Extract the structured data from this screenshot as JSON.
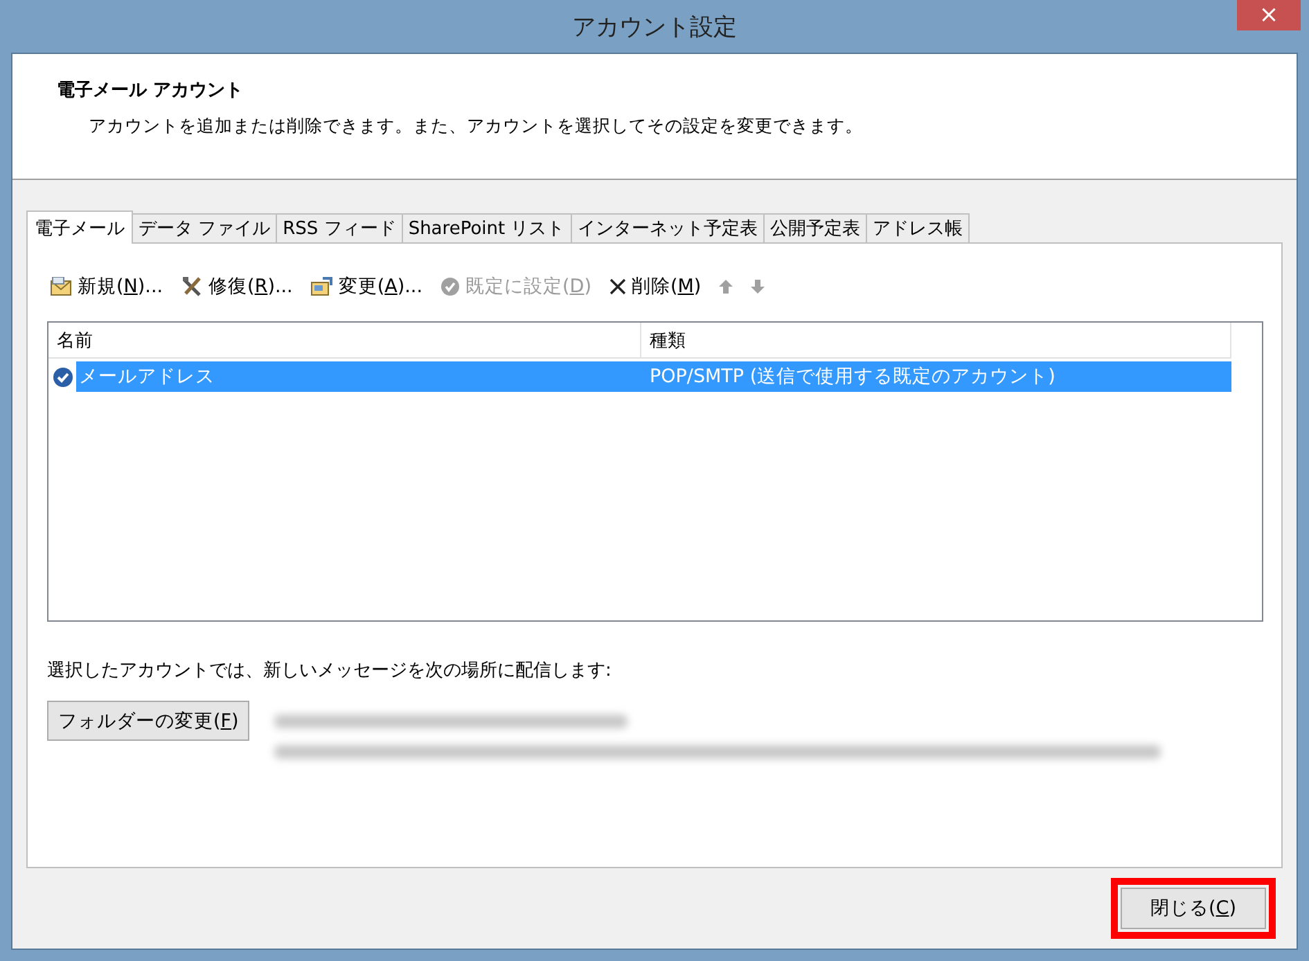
{
  "window": {
    "title": "アカウント設定",
    "close": "×"
  },
  "header": {
    "title": "電子メール アカウント",
    "description": "アカウントを追加または削除できます。また、アカウントを選択してその設定を変更できます。"
  },
  "tabs": [
    {
      "label": "電子メール",
      "selected": true
    },
    {
      "label": "データ ファイル",
      "selected": false
    },
    {
      "label": "RSS フィード",
      "selected": false
    },
    {
      "label": "SharePoint リスト",
      "selected": false
    },
    {
      "label": "インターネット予定表",
      "selected": false
    },
    {
      "label": "公開予定表",
      "selected": false
    },
    {
      "label": "アドレス帳",
      "selected": false
    }
  ],
  "toolbar": [
    {
      "kind": "new",
      "text": "新規(",
      "key": "N",
      "tail": ")...",
      "disabled": false
    },
    {
      "kind": "repair",
      "text": "修復(",
      "key": "R",
      "tail": ")...",
      "disabled": false
    },
    {
      "kind": "change",
      "text": "変更(",
      "key": "A",
      "tail": ")...",
      "disabled": false
    },
    {
      "kind": "default",
      "text": "既定に設定(",
      "key": "D",
      "tail": ")",
      "disabled": true
    },
    {
      "kind": "delete",
      "text": "削除(",
      "key": "M",
      "tail": ")",
      "disabled": false
    },
    {
      "kind": "up",
      "disabled": true
    },
    {
      "kind": "down",
      "disabled": true
    }
  ],
  "table": {
    "columns": [
      "名前",
      "種類"
    ],
    "rows": [
      {
        "name": "メールアドレス",
        "type": "POP/SMTP (送信で使用する既定のアカウント)",
        "selected": true,
        "default": true
      }
    ]
  },
  "delivery": {
    "label": "選択したアカウントでは、新しいメッセージを次の場所に配信します:",
    "button": {
      "text": "フォルダーの変更(",
      "key": "F",
      "tail": ")"
    }
  },
  "footer": {
    "close_button": {
      "text": "閉じる(",
      "key": "C",
      "tail": ")",
      "highlighted": true
    }
  }
}
